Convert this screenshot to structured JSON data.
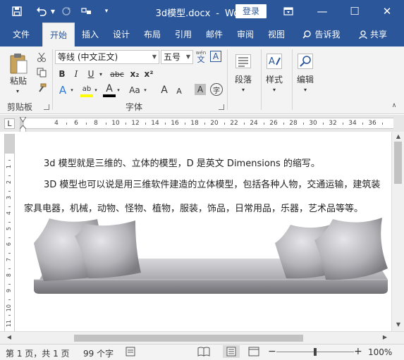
{
  "titlebar": {
    "doc_title": "3d模型.docx",
    "separator": "-",
    "app_name": "Word",
    "login_label": "登录",
    "window_controls": {
      "minimize": "—",
      "maximize": "☐",
      "close": "✕"
    }
  },
  "tabs": [
    {
      "label": "文件"
    },
    {
      "label": "开始"
    },
    {
      "label": "插入"
    },
    {
      "label": "设计"
    },
    {
      "label": "布局"
    },
    {
      "label": "引用"
    },
    {
      "label": "邮件"
    },
    {
      "label": "审阅"
    },
    {
      "label": "视图"
    },
    {
      "label": "告诉我"
    },
    {
      "label": "共享"
    }
  ],
  "ribbon": {
    "clipboard": {
      "paste_label": "粘贴",
      "group_label": "剪贴板"
    },
    "font": {
      "font_name": "等线 (中文正文)",
      "font_size": "五号",
      "wen_label": "wén",
      "wen_char": "文",
      "a_box": "A",
      "bold": "B",
      "italic": "I",
      "underline": "U",
      "strike": "abc",
      "subscript": "x₂",
      "superscript": "x²",
      "text_effects": "A",
      "highlight": "ab",
      "font_color": "A",
      "change_case": "Aa",
      "grow": "A",
      "shrink": "A",
      "char_shading": "A",
      "enclose": "字",
      "group_label": "字体"
    },
    "paragraph": {
      "label": "段落"
    },
    "styles": {
      "label": "样式"
    },
    "editing": {
      "label": "编辑"
    }
  },
  "ruler": {
    "corner": "L",
    "ticks": [
      "4",
      "6",
      "8",
      "10",
      "12",
      "14",
      "16",
      "18",
      "20",
      "22",
      "24",
      "26",
      "28",
      "30",
      "32",
      "34",
      "36"
    ],
    "vticks": [
      "1",
      "2",
      "3",
      "4",
      "5",
      "6",
      "7",
      "8",
      "9",
      "10",
      "11"
    ]
  },
  "document": {
    "paragraphs": [
      "3d 模型就是三维的、立体的模型，D 是英文 Dimensions 的缩写。",
      "3D 模型也可以说是用三维软件建造的立体模型，包括各种人物，交通运输，建筑装",
      "家具电器，机械，动物、怪物、植物，服装，饰品，日常用品，乐器，艺术品等等。"
    ]
  },
  "statusbar": {
    "page": "第 1 页，共 1 页",
    "words": "99 个字",
    "zoom": "100%",
    "zoom_minus": "−",
    "zoom_plus": "+",
    "zoom_level": 1.0
  },
  "colors": {
    "accent": "#2b579a",
    "ribbon_bg": "#f3f3f3"
  }
}
